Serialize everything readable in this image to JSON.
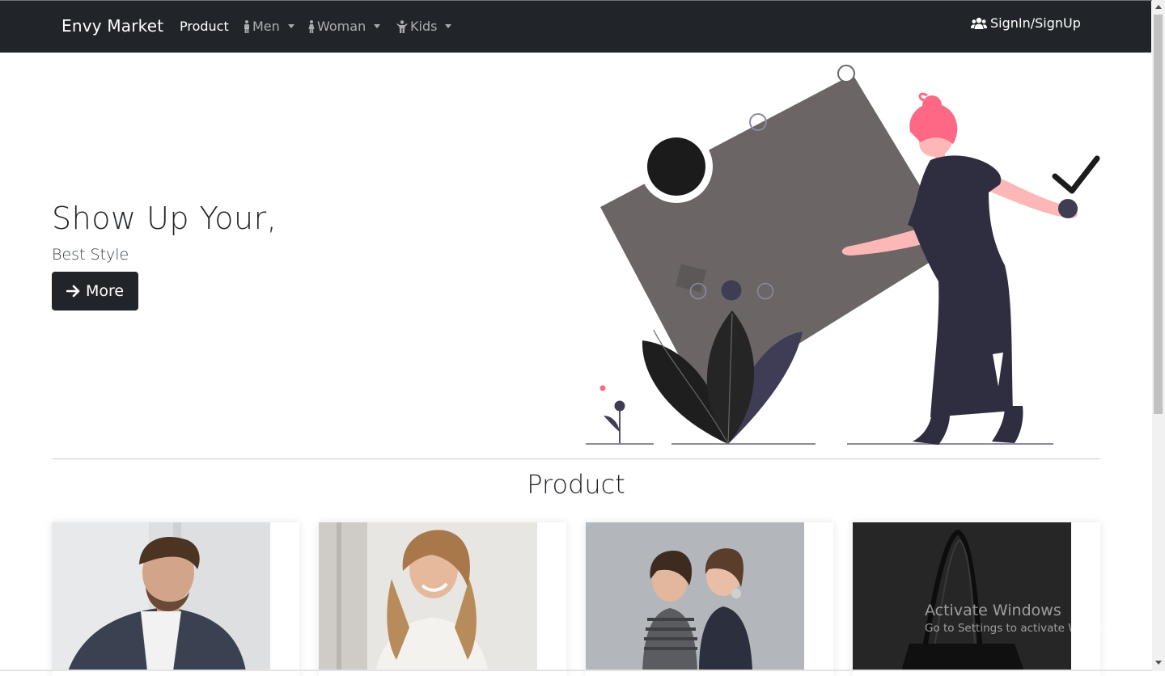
{
  "navbar": {
    "brand": "Envy Market",
    "product": "Product",
    "men": "Men",
    "woman": "Woman",
    "kids": "Kids",
    "signin": "SignIn/SignUp"
  },
  "hero": {
    "title": "Show Up Your,",
    "subtitle": "Best Style",
    "button": "More"
  },
  "section": {
    "title": "Product"
  },
  "watermark": {
    "title": "Activate Windows",
    "subtitle": "Go to Settings to activate Windows."
  },
  "colors": {
    "navbar": "#212529",
    "accent_pink": "#ff6884",
    "purple": "#3f3d56",
    "card_tile": "#6b6665"
  },
  "icons": {
    "men": "male-icon",
    "woman": "female-icon",
    "kids": "child-icon",
    "signin": "users-icon",
    "more": "arrow-right-icon"
  }
}
